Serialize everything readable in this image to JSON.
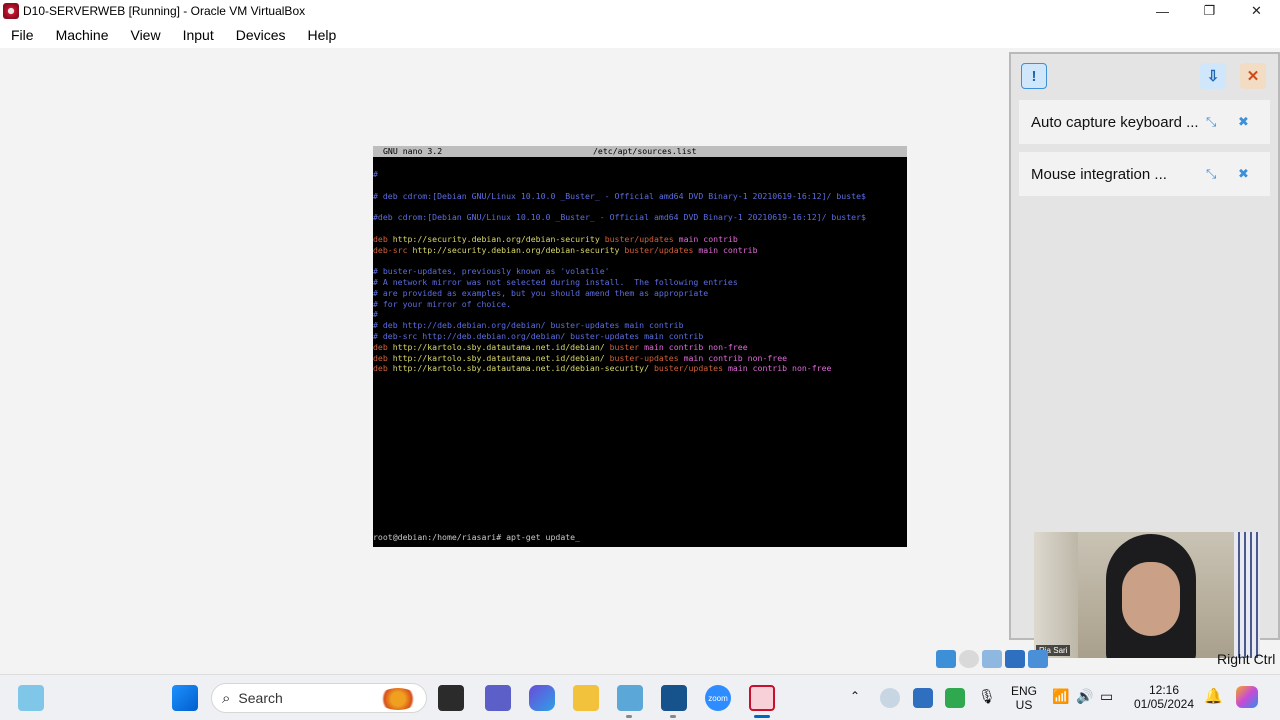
{
  "window": {
    "title": "D10-SERVERWEB [Running] - Oracle VM VirtualBox",
    "controls": {
      "minimize": "—",
      "restore": "❐",
      "close": "✕"
    }
  },
  "menu": [
    "File",
    "Machine",
    "View",
    "Input",
    "Devices",
    "Help"
  ],
  "nano": {
    "version": "GNU nano 3.2",
    "filename": "/etc/apt/sources.list"
  },
  "terminal_lines": [
    [
      {
        "t": "#",
        "c": "com"
      }
    ],
    [
      {
        "t": "",
        "c": "com"
      }
    ],
    [
      {
        "t": "# deb cdrom:[Debian GNU/Linux 10.10.0 _Buster_ - Official amd64 DVD Binary-1 20210619-16:12]/ buste$",
        "c": "com"
      }
    ],
    [
      {
        "t": "",
        "c": "com"
      }
    ],
    [
      {
        "t": "#deb cdrom:[Debian GNU/Linux 10.10.0 _Buster_ - Official amd64 DVD Binary-1 20210619-16:12]/ buster$",
        "c": "com"
      }
    ],
    [
      {
        "t": "",
        "c": "com"
      }
    ],
    [
      {
        "t": "deb ",
        "c": "deb"
      },
      {
        "t": "http://security.debian.org/debian-security ",
        "c": "url"
      },
      {
        "t": "buster/updates ",
        "c": "dist"
      },
      {
        "t": "main contrib",
        "c": "comp"
      }
    ],
    [
      {
        "t": "deb-src ",
        "c": "deb"
      },
      {
        "t": "http://security.debian.org/debian-security ",
        "c": "url"
      },
      {
        "t": "buster/updates ",
        "c": "dist"
      },
      {
        "t": "main contrib",
        "c": "comp"
      }
    ],
    [
      {
        "t": "",
        "c": "com"
      }
    ],
    [
      {
        "t": "# buster-updates, previously known as 'volatile'",
        "c": "com"
      }
    ],
    [
      {
        "t": "# A network mirror was not selected during install.  The following entries",
        "c": "com"
      }
    ],
    [
      {
        "t": "# are provided as examples, but you should amend them as appropriate",
        "c": "com"
      }
    ],
    [
      {
        "t": "# for your mirror of choice.",
        "c": "com"
      }
    ],
    [
      {
        "t": "#",
        "c": "com"
      }
    ],
    [
      {
        "t": "# deb http://deb.debian.org/debian/ buster-updates main contrib",
        "c": "com"
      }
    ],
    [
      {
        "t": "# deb-src http://deb.debian.org/debian/ buster-updates main contrib",
        "c": "com"
      }
    ],
    [
      {
        "t": "deb ",
        "c": "deb"
      },
      {
        "t": "http://kartolo.sby.datautama.net.id/debian/ ",
        "c": "url"
      },
      {
        "t": "buster ",
        "c": "dist"
      },
      {
        "t": "main contrib non-free",
        "c": "comp"
      }
    ],
    [
      {
        "t": "deb ",
        "c": "deb"
      },
      {
        "t": "http://kartolo.sby.datautama.net.id/debian/ ",
        "c": "url"
      },
      {
        "t": "buster-updates ",
        "c": "dist"
      },
      {
        "t": "main contrib non-free",
        "c": "comp"
      }
    ],
    [
      {
        "t": "deb ",
        "c": "deb"
      },
      {
        "t": "http://kartolo.sby.datautama.net.id/debian-security/ ",
        "c": "url"
      },
      {
        "t": "buster/updates ",
        "c": "dist"
      },
      {
        "t": "main contrib non-free",
        "c": "comp"
      }
    ]
  ],
  "prompt": "root@debian:/home/riasari# apt-get update_",
  "notifications": {
    "keyboard": "Auto capture keyboard ...",
    "mouse": "Mouse integration ..."
  },
  "host_key": "Right Ctrl",
  "webcam_label": "Ria Sari",
  "taskbar": {
    "search_placeholder": "Search",
    "language": "ENG",
    "region": "US",
    "time": "12:16",
    "date": "01/05/2024",
    "zoom_label": "zoom"
  },
  "colors": {
    "comment": "#5b6de0",
    "deb": "#d0603a",
    "url": "#d8d86a",
    "component": "#e06ad8",
    "accent": "#0067c0"
  }
}
